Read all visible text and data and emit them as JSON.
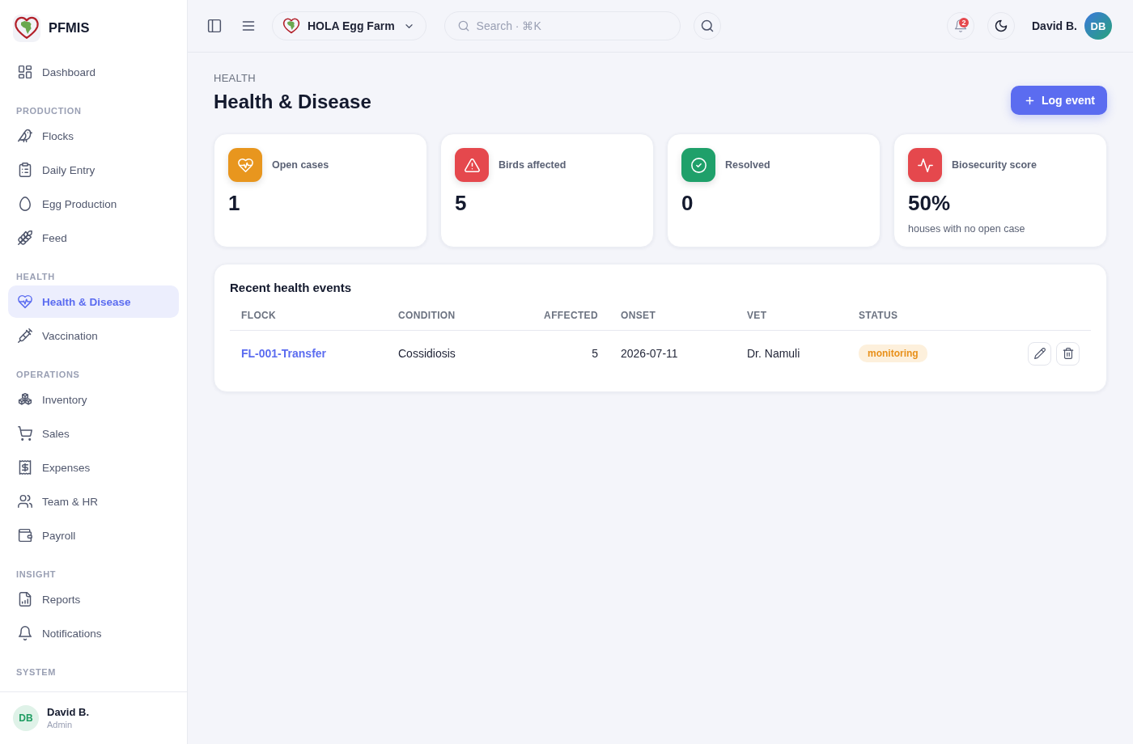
{
  "sidebar": {
    "brand": "PFMIS",
    "sections": [
      {
        "items": [
          {
            "label": "Dashboard",
            "selected": false
          }
        ]
      },
      {
        "title": "PRODUCTION",
        "items": [
          {
            "label": "Flocks",
            "selected": false
          },
          {
            "label": "Daily Entry",
            "selected": false
          },
          {
            "label": "Egg Production",
            "selected": false
          },
          {
            "label": "Feed",
            "selected": false
          }
        ]
      },
      {
        "title": "HEALTH",
        "items": [
          {
            "label": "Health & Disease",
            "selected": true
          },
          {
            "label": "Vaccination",
            "selected": false
          }
        ]
      },
      {
        "title": "OPERATIONS",
        "items": [
          {
            "label": "Inventory",
            "selected": false
          },
          {
            "label": "Sales",
            "selected": false
          },
          {
            "label": "Expenses",
            "selected": false
          },
          {
            "label": "Team & HR",
            "selected": false
          },
          {
            "label": "Payroll",
            "selected": false
          }
        ]
      },
      {
        "title": "INSIGHT",
        "items": [
          {
            "label": "Reports",
            "selected": false
          },
          {
            "label": "Notifications",
            "selected": false
          }
        ]
      },
      {
        "title": "SYSTEM"
      }
    ],
    "user": {
      "initials": "DB",
      "name": "David B.",
      "role": "Admin"
    }
  },
  "topbar": {
    "farm": "HOLA Egg Farm",
    "search": {
      "placeholder": "Search · ⌘K"
    },
    "notifications": "2",
    "user": {
      "name": "David B.",
      "initials": "DB"
    }
  },
  "page": {
    "breadcrumb": "HEALTH",
    "title": "Health & Disease",
    "action": "Log event"
  },
  "stats": [
    {
      "label": "Open cases",
      "value": "1",
      "color": "#e8961e"
    },
    {
      "label": "Birds affected",
      "value": "5",
      "color": "#e5484d"
    },
    {
      "label": "Resolved",
      "value": "0",
      "color": "#1fa06a"
    },
    {
      "label": "Biosecurity score",
      "value": "50%",
      "note": "houses with no open case",
      "color": "#e5484d"
    }
  ],
  "events": {
    "title": "Recent health events",
    "columns": [
      "FLOCK",
      "CONDITION",
      "AFFECTED",
      "ONSET",
      "VET",
      "STATUS"
    ],
    "rows": [
      {
        "flock": "FL-001-Transfer",
        "condition": "Cossidiosis",
        "affected": "5",
        "onset": "2026-07-11",
        "vet": "Dr. Namuli",
        "status": "monitoring"
      }
    ]
  }
}
